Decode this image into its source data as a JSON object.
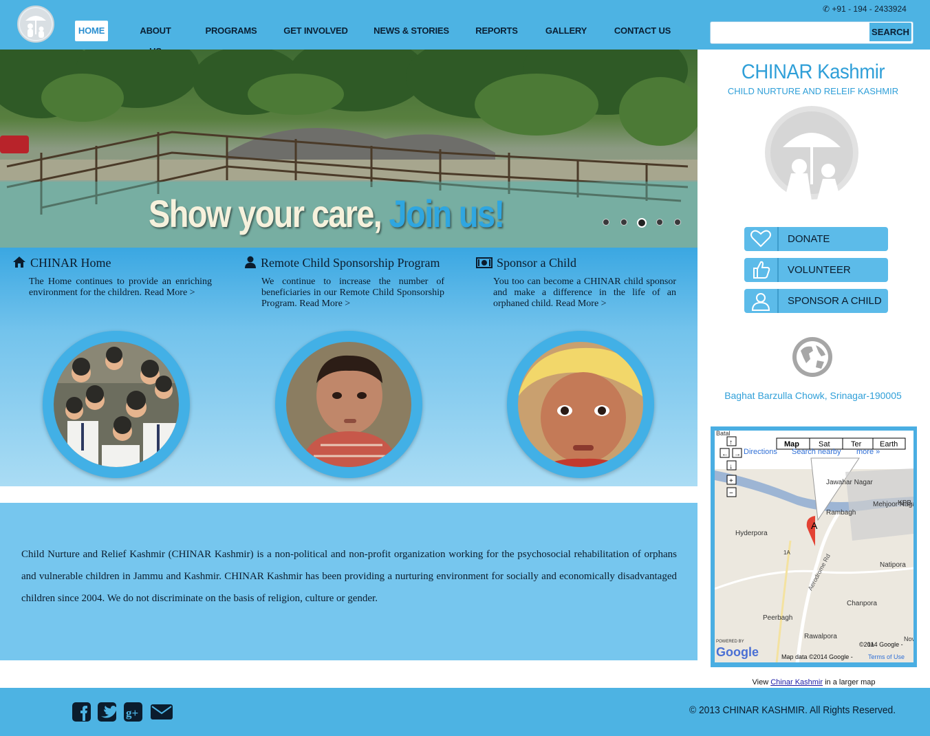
{
  "header": {
    "phone": "+91 - 194 - 2433924",
    "nav": [
      {
        "label": "HOME",
        "active": true
      },
      {
        "label": "ABOUT US"
      },
      {
        "label": "PROGRAMS"
      },
      {
        "label": "GET INVOLVED"
      },
      {
        "label": "NEWS & STORIES"
      },
      {
        "label": "REPORTS"
      },
      {
        "label": "GALLERY"
      },
      {
        "label": "CONTACT US"
      }
    ],
    "search": {
      "placeholder": "",
      "button_label": "SEARCH"
    }
  },
  "hero": {
    "caption_main": "Show your care,",
    "caption_accent": "Join us!",
    "slides_total": 5,
    "active_slide": 3
  },
  "features": [
    {
      "icon": "home-icon",
      "title": "CHINAR Home",
      "text": "The Home continues to provide an enriching environment for the children.",
      "link": "Read More >"
    },
    {
      "icon": "user-icon",
      "title": "Remote Child Sponsorship Program",
      "text": "We continue to increase the number of beneficiaries in our Remote Child Sponsorship Program.",
      "link": "Read More >"
    },
    {
      "icon": "money-icon",
      "title": "Sponsor a Child",
      "text": "You too can become a CHINAR child sponsor and make a difference in the life of an orphaned child.",
      "link": "Read More >"
    }
  ],
  "about": {
    "text": "Child Nurture and Relief Kashmir (CHINAR Kashmir) is a non-political and non-profit organization working for the psychosocial rehabilitation of orphans and vulnerable children in Jammu and Kashmir. CHINAR Kashmir has been providing a nurturing environment for socially and economically disadvantaged children since 2004. We do not discriminate on the basis of religion, culture or gender."
  },
  "sidebar": {
    "org_name": "CHINAR Kashmir",
    "org_subtitle": "CHILD NURTURE AND RELEIF KASHMIR",
    "buttons": [
      {
        "label": "DONATE",
        "icon": "heart-icon"
      },
      {
        "label": "VOLUNTEER",
        "icon": "thumbs-up-icon"
      },
      {
        "label": "SPONSOR A CHILD",
        "icon": "person-icon"
      }
    ],
    "address": "Baghat Barzulla Chowk, Srinagar-190005",
    "map": {
      "types": [
        "Map",
        "Sat",
        "Ter",
        "Earth"
      ],
      "active_type": "Map",
      "links": [
        "Directions",
        "Search nearby",
        "more »"
      ],
      "places": [
        "Batal",
        "Jawahar Nagar",
        "Rambagh",
        "Mehjoor Nagar",
        "KPB",
        "Hyderpora",
        "Natipora",
        "Chanpora",
        "Peerbagh",
        "Rawalpora",
        "Aerodrome Rd",
        "1A",
        "1A",
        "Nov"
      ],
      "marker": "A",
      "copyright": "©2014 Google -",
      "map_data": "Map data ©2014 Google -",
      "terms": "Terms of Use",
      "powered_by": "POWERED BY",
      "google": "Google"
    },
    "map_caption": {
      "prefix": "View",
      "link": "Chinar Kashmir",
      "suffix": "in a larger map"
    }
  },
  "footer": {
    "social": [
      "facebook-icon",
      "twitter-icon",
      "google-plus-icon",
      "email-icon"
    ],
    "copyright": "© 2013 CHINAR KASHMIR. All Rights Reserved."
  },
  "colors": {
    "brand_blue": "#4db3e3",
    "accent": "#2f9fd8"
  }
}
